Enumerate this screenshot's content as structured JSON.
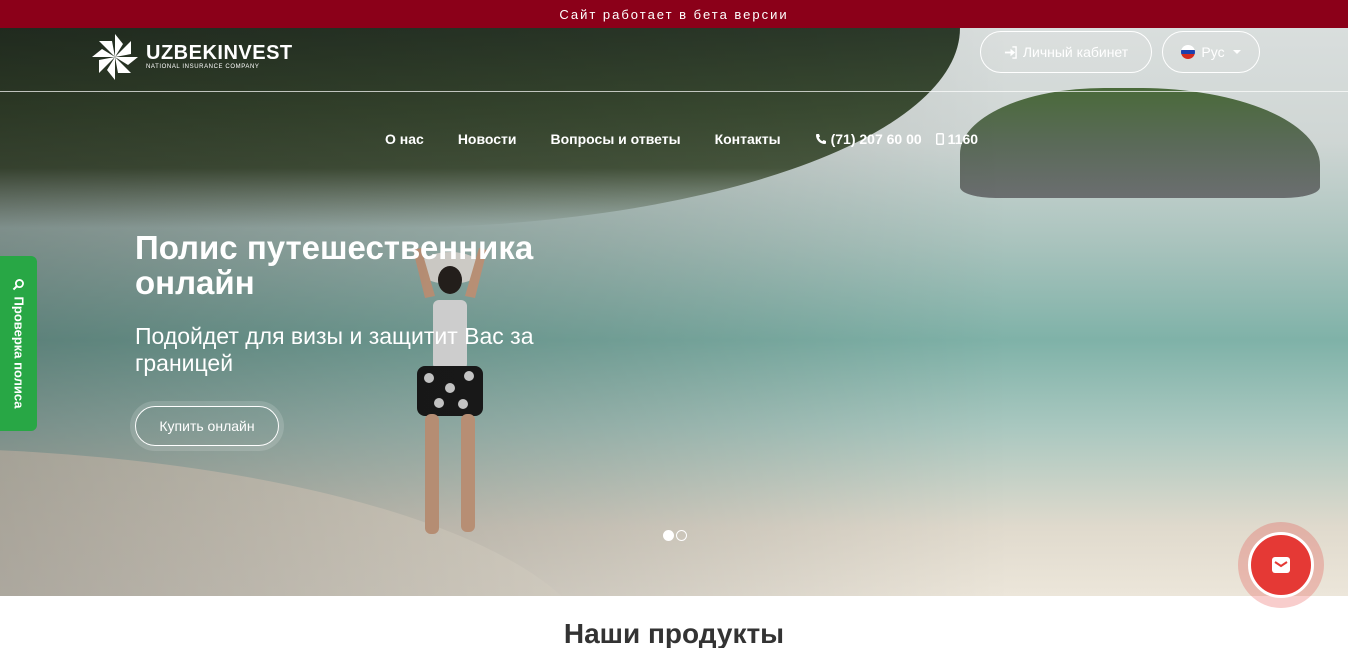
{
  "beta_banner": "Сайт работает в бета версии",
  "logo": {
    "name": "UZBEKINVEST",
    "tagline": "NATIONAL INSURANCE COMPANY"
  },
  "header": {
    "cabinet_label": "Личный кабинет",
    "cabinet_icon": "sign-in-icon",
    "language_label": "Рус",
    "language_flag": "russia-flag-icon"
  },
  "nav": {
    "items": [
      "О нас",
      "Новости",
      "Вопросы и ответы",
      "Контакты"
    ],
    "phone": "(71) 207 60 00",
    "short_number": "1160"
  },
  "hero": {
    "title": "Полис путешественника онлайн",
    "subtitle": "Подойдет для визы и защитит Вас за границей",
    "cta": "Купить онлайн",
    "slides_total": 2,
    "active_slide": 1
  },
  "side_tab": {
    "label": "Проверка полиса",
    "icon": "search-icon"
  },
  "fab": {
    "icon": "envelope-icon",
    "color": "#e53935"
  },
  "section": {
    "title": "Наши продукты"
  },
  "colors": {
    "banner": "#8b0019",
    "side_tab": "#28a745",
    "fab": "#e53935"
  }
}
